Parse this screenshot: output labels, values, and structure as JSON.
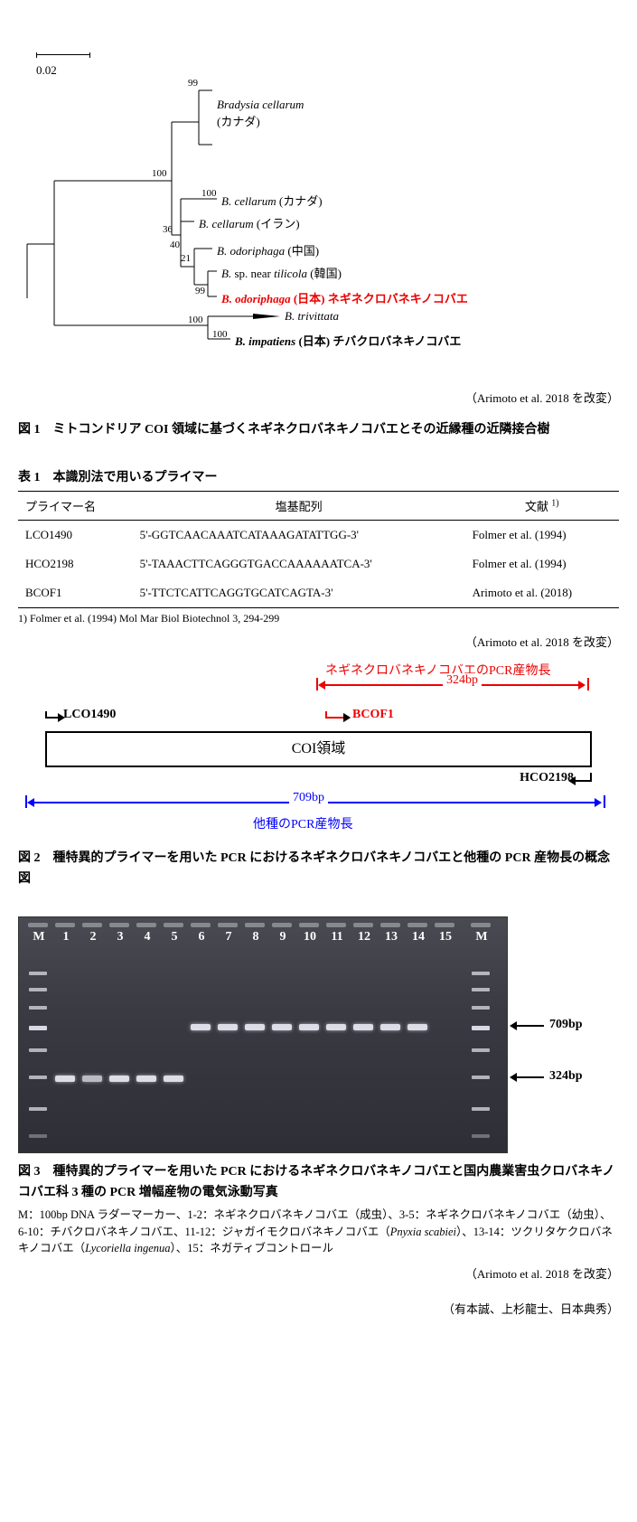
{
  "tree": {
    "scale": "0.02",
    "bootstrap": {
      "a": "99",
      "b": "100",
      "c": "100",
      "d": "36",
      "e": "40",
      "f": "21",
      "g": "99",
      "h": "100",
      "i": "100"
    },
    "taxa": {
      "t1_name": "Bradysia cellarum",
      "t1_loc": "(カナダ)",
      "t2": "B. cellarum (カナダ)",
      "t2_italic": "B. cellarum",
      "t2_loc": " (カナダ)",
      "t3_italic": "B. cellarum",
      "t3_loc": " (イラン)",
      "t4_italic": "B. odoriphaga",
      "t4_loc": " (中国)",
      "t5_pre": "B.",
      "t5_mid": " sp. near ",
      "t5_italic2": "tilicola",
      "t5_loc": " (韓国)",
      "t6_italic": "B. odoriphaga",
      "t6_loc": " (日本) ネギネクロバネキノコバエ",
      "t7_italic": "B. trivittata",
      "t8_italic": "B. impatiens",
      "t8_loc": " (日本) チバクロバネキノコバエ"
    },
    "attribution": "（Arimoto et al. 2018 を改変）"
  },
  "fig1_caption": "図 1　ミトコンドリア COI 領域に基づくネギネクロバネキノコバエとその近縁種の近隣接合樹",
  "table1": {
    "caption": "表 1　本識別法で用いるプライマー",
    "headers": {
      "c1": "プライマー名",
      "c2": "塩基配列",
      "c3_pre": "文献",
      "c3_sup": "1)"
    },
    "rows": [
      {
        "name": "LCO1490",
        "seq": "5'-GGTCAACAAATCATAAAGATATTGG-3'",
        "ref": "Folmer et al. (1994)"
      },
      {
        "name": "HCO2198",
        "seq": "5'-TAAACTTCAGGGTGACCAAAAAATCA-3'",
        "ref": "Folmer et al. (1994)"
      },
      {
        "name": "BCOF1",
        "seq": "5'-TTCTCATTCAGGTGCATCAGTA-3'",
        "ref": "Arimoto et al. (2018)"
      }
    ],
    "footnote": "1) Folmer et al. (1994) Mol Mar Biol Biotechnol 3, 294-299",
    "attribution": "（Arimoto et al. 2018 を改変）"
  },
  "fig2": {
    "red_title": "ネギネクロバネキノコバエのPCR産物長",
    "red_len": "324bp",
    "lco": "LCO1490",
    "bcof": "BCOF1",
    "coi": "COI領域",
    "hco": "HCO2198",
    "blue_len": "709bp",
    "blue_title": "他種のPCR産物長",
    "caption": "図 2　種特異的プライマーを用いた PCR におけるネギネクロバネキノコバエと他種の PCR 産物長の概念図"
  },
  "fig3": {
    "lanes": [
      "M",
      "1",
      "2",
      "3",
      "4",
      "5",
      "6",
      "7",
      "8",
      "9",
      "10",
      "11",
      "12",
      "13",
      "14",
      "15",
      "M"
    ],
    "band709": "709bp",
    "band324": "324bp",
    "caption": "図 3　種特異的プライマーを用いた PCR におけるネギネクロバネキノコバエと国内農業害虫クロバネキノコバエ科 3 種の PCR 増幅産物の電気泳動写真",
    "desc_1": "M：100bp DNA ラダーマーカー、1-2：ネギネクロバネキノコバエ（成虫）、3-5：ネギネクロバネキノコバエ（幼虫）、6-10：チバクロバネキノコバエ、11-12：ジャガイモクロバネキノコバエ（",
    "desc_pnyxia": "Pnyxia scabiei",
    "desc_2": "）、13-14：ツクリタケクロバネキノコバエ（",
    "desc_lyco": "Lycoriella ingenua",
    "desc_3": "）、15：ネガティブコントロール",
    "attribution": "（Arimoto et al. 2018 を改変）"
  },
  "authors": "（有本誠、上杉龍士、日本典秀）",
  "chart_data": [
    {
      "type": "other",
      "subtype": "phylogenetic_tree",
      "title": "ミトコンドリア COI 領域に基づくネギネクロバネキノコバエとその近縁種の近隣接合樹",
      "scale_bar": 0.02,
      "taxa": [
        {
          "label": "Bradysia cellarum",
          "locality": "カナダ"
        },
        {
          "label": "B. cellarum",
          "locality": "カナダ"
        },
        {
          "label": "B. cellarum",
          "locality": "イラン"
        },
        {
          "label": "B. odoriphaga",
          "locality": "中国"
        },
        {
          "label": "B. sp. near tilicola",
          "locality": "韓国"
        },
        {
          "label": "B. odoriphaga",
          "locality": "日本",
          "common_name": "ネギネクロバネキノコバエ",
          "highlight": true
        },
        {
          "label": "B. trivittata"
        },
        {
          "label": "B. impatiens",
          "locality": "日本",
          "common_name": "チバクロバネキノコバエ"
        }
      ],
      "bootstrap_values_shown": [
        99,
        100,
        100,
        36,
        40,
        21,
        99,
        100,
        100
      ]
    },
    {
      "type": "table",
      "title": "本識別法で用いるプライマー",
      "columns": [
        "プライマー名",
        "塩基配列",
        "文献"
      ],
      "rows": [
        [
          "LCO1490",
          "5'-GGTCAACAAATCATAAAGATATTGG-3'",
          "Folmer et al. (1994)"
        ],
        [
          "HCO2198",
          "5'-TAAACTTCAGGGTGACCAAAAAATCA-3'",
          "Folmer et al. (1994)"
        ],
        [
          "BCOF1",
          "5'-TTCTCATTCAGGTGCATCAGTA-3'",
          "Arimoto et al. (2018)"
        ]
      ]
    },
    {
      "type": "other",
      "subtype": "schematic",
      "title": "種特異的プライマーを用いた PCR におけるネギネクロバネキノコバエと他種の PCR 産物長の概念図",
      "region": "COI領域",
      "primers": [
        {
          "name": "LCO1490",
          "direction": "forward",
          "position": "left"
        },
        {
          "name": "BCOF1",
          "direction": "forward",
          "position": "internal",
          "target": "ネギネクロバネキノコバエ"
        },
        {
          "name": "HCO2198",
          "direction": "reverse",
          "position": "right"
        }
      ],
      "products": [
        {
          "label": "ネギネクロバネキノコバエのPCR産物長",
          "length_bp": 324,
          "primers": [
            "BCOF1",
            "HCO2198"
          ]
        },
        {
          "label": "他種のPCR産物長",
          "length_bp": 709,
          "primers": [
            "LCO1490",
            "HCO2198"
          ]
        }
      ]
    },
    {
      "type": "other",
      "subtype": "gel_electrophoresis",
      "title": "種特異的プライマーを用いた PCR におけるネギネクロバネキノコバエと国内農業害虫クロバネキノコバエ科 3 種の PCR 増幅産物の電気泳動写真",
      "lanes": [
        {
          "lane": "M",
          "content": "100bp DNA ラダーマーカー"
        },
        {
          "lane": "1",
          "content": "ネギネクロバネキノコバエ（成虫）",
          "band_bp": 324
        },
        {
          "lane": "2",
          "content": "ネギネクロバネキノコバエ（成虫）",
          "band_bp": 324
        },
        {
          "lane": "3",
          "content": "ネギネクロバネキノコバエ（幼虫）",
          "band_bp": 324
        },
        {
          "lane": "4",
          "content": "ネギネクロバネキノコバエ（幼虫）",
          "band_bp": 324
        },
        {
          "lane": "5",
          "content": "ネギネクロバネキノコバエ（幼虫）",
          "band_bp": 324
        },
        {
          "lane": "6",
          "content": "チバクロバネキノコバエ",
          "band_bp": 709
        },
        {
          "lane": "7",
          "content": "チバクロバネキノコバエ",
          "band_bp": 709
        },
        {
          "lane": "8",
          "content": "チバクロバネキノコバエ",
          "band_bp": 709
        },
        {
          "lane": "9",
          "content": "チバクロバネキノコバエ",
          "band_bp": 709
        },
        {
          "lane": "10",
          "content": "チバクロバネキノコバエ",
          "band_bp": 709
        },
        {
          "lane": "11",
          "content": "ジャガイモクロバネキノコバエ (Pnyxia scabiei)",
          "band_bp": 709
        },
        {
          "lane": "12",
          "content": "ジャガイモクロバネキノコバエ (Pnyxia scabiei)",
          "band_bp": 709
        },
        {
          "lane": "13",
          "content": "ツクリタケクロバネキノコバエ (Lycoriella ingenua)",
          "band_bp": 709
        },
        {
          "lane": "14",
          "content": "ツクリタケクロバネキノコバエ (Lycoriella ingenua)",
          "band_bp": 709
        },
        {
          "lane": "15",
          "content": "ネガティブコントロール",
          "band_bp": null
        },
        {
          "lane": "M",
          "content": "100bp DNA ラダーマーカー"
        }
      ],
      "annotated_sizes_bp": [
        709,
        324
      ]
    }
  ]
}
